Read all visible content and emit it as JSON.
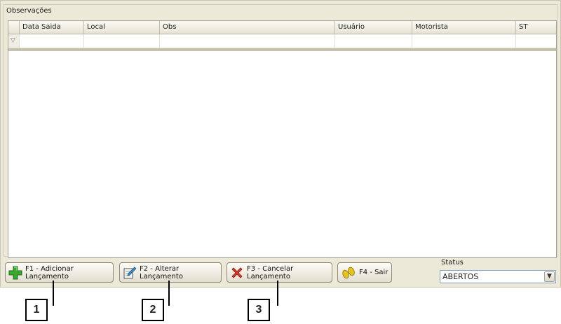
{
  "panel": {
    "title": "Observações"
  },
  "grid": {
    "columns": [
      "Data Saida",
      "Local",
      "Obs",
      "Usuário",
      "Motorista",
      "ST"
    ]
  },
  "buttons": {
    "add": "F1 - Adicionar Lançamento",
    "edit": "F2 - Alterar Lançamento",
    "cancel": "F3 - Cancelar Lançamento",
    "exit": "F4 - Sair"
  },
  "status": {
    "label": "Status",
    "value": "ABERTOS"
  },
  "callouts": [
    "1",
    "2",
    "3"
  ],
  "icons": {
    "add": "plus-icon",
    "edit": "notepad-pencil-icon",
    "cancel": "red-x-icon",
    "exit": "footprints-icon",
    "filter": "filter-icon",
    "dropdown": "chevron-down-icon"
  },
  "colors": {
    "add": "#3aa82f",
    "cancel": "#d93a2a",
    "exit": "#e6c21a",
    "window": "#ece9d8"
  }
}
